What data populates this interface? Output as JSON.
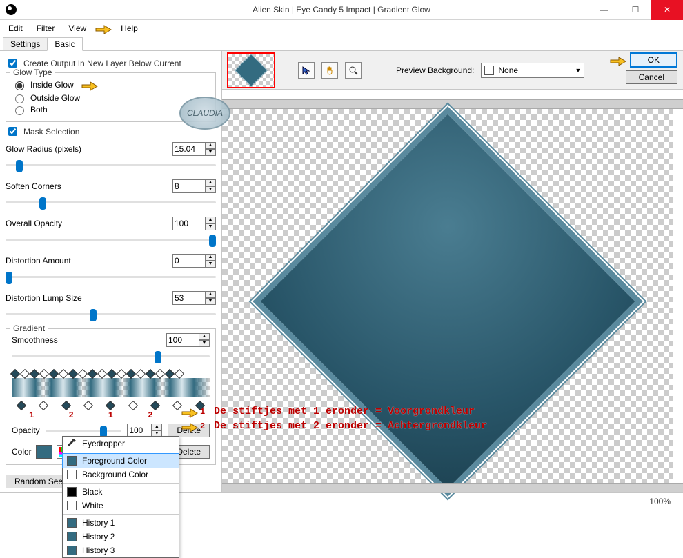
{
  "window": {
    "title": "Alien Skin | Eye Candy 5 Impact | Gradient Glow"
  },
  "menu": {
    "edit": "Edit",
    "filter": "Filter",
    "view": "View",
    "help": "Help"
  },
  "tabs": {
    "settings": "Settings",
    "basic": "Basic"
  },
  "ckCreateOutput": "Create Output In New Layer Below Current",
  "glowType": {
    "legend": "Glow Type",
    "inside": "Inside Glow",
    "outside": "Outside Glow",
    "both": "Both"
  },
  "ckMask": "Mask Selection",
  "sliders": {
    "glowRadius": {
      "label": "Glow Radius (pixels)",
      "value": "15.04"
    },
    "softenCorners": {
      "label": "Soften Corners",
      "value": "8"
    },
    "overallOpacity": {
      "label": "Overall Opacity",
      "value": "100"
    },
    "distortionAmount": {
      "label": "Distortion Amount",
      "value": "0"
    },
    "distortionLump": {
      "label": "Distortion Lump Size",
      "value": "53"
    }
  },
  "gradient": {
    "legend": "Gradient",
    "smoothness": {
      "label": "Smoothness",
      "value": "100"
    },
    "opacityLabel": "Opacity",
    "opacityVal": "100",
    "deleteBtn1": "Delete",
    "colorLabel": "Color",
    "deleteBtn2": "Delete",
    "bottomMarks": [
      "1",
      "2",
      "1",
      "2",
      "1"
    ]
  },
  "randomSeed": "Random Seed",
  "colorPopup": {
    "eyedropper": "Eyedropper",
    "fg": "Foreground Color",
    "bg": "Background Color",
    "black": "Black",
    "white": "White",
    "h1": "History 1",
    "h2": "History 2",
    "h3": "History 3"
  },
  "rightTop": {
    "previewBgLabel": "Preview Background:",
    "previewBgValue": "None",
    "ok": "OK",
    "cancel": "Cancel"
  },
  "annot": {
    "num1": "1",
    "num2": "2",
    "line1": "De stiftjes met 1 eronder = Voorgrondkleur",
    "line2": "De stiftjes met 2 eronder = Achtergrondkleur"
  },
  "status": {
    "zoom": "100%"
  },
  "watermark": "CLAUDIA"
}
